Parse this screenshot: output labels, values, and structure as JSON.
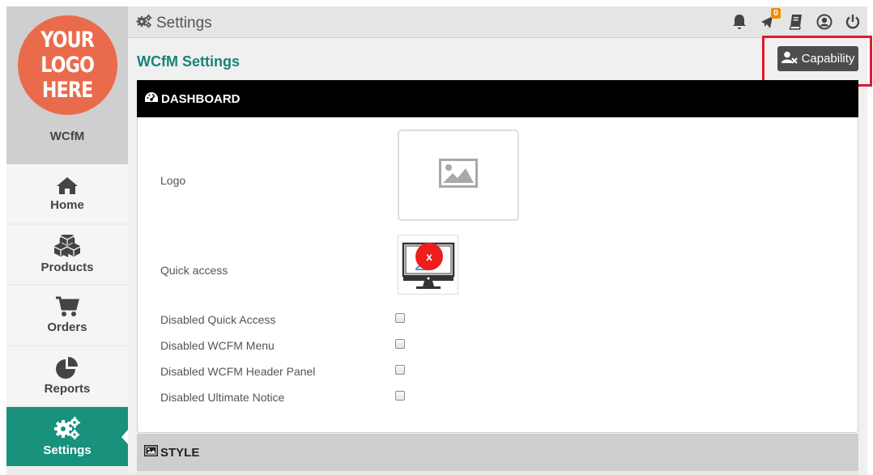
{
  "sidebar": {
    "logo_lines": [
      "YOUR",
      "LOGO",
      "HERE"
    ],
    "store_name": "WCfM",
    "items": [
      {
        "label": "Home",
        "icon": "home-icon"
      },
      {
        "label": "Products",
        "icon": "cubes-icon"
      },
      {
        "label": "Orders",
        "icon": "cart-icon"
      },
      {
        "label": "Reports",
        "icon": "pie-chart-icon"
      },
      {
        "label": "Settings",
        "icon": "gears-icon",
        "active": true
      }
    ]
  },
  "header": {
    "title": "Settings",
    "icons": [
      "bell-icon",
      "megaphone-icon",
      "book-icon",
      "user-circle-icon",
      "power-icon"
    ],
    "megaphone_badge": "0"
  },
  "main": {
    "title": "WCfM Settings",
    "capability_button": "Capability",
    "dashboard_section": {
      "title": "DASHBOARD",
      "logo_label": "Logo",
      "quick_access_label": "Quick access",
      "quick_access_remove": "x",
      "checkboxes": [
        {
          "label": "Disabled Quick Access",
          "checked": false
        },
        {
          "label": "Disabled WCFM Menu",
          "checked": false
        },
        {
          "label": "Disabled WCFM Header Panel",
          "checked": false
        },
        {
          "label": "Disabled Ultimate Notice",
          "checked": false
        }
      ]
    },
    "style_section": {
      "title": "STYLE"
    }
  },
  "colors": {
    "accent": "#18917d",
    "title_teal": "#17827a",
    "logo_orange": "#ea6b4b",
    "highlight_red": "#e01a2e",
    "badge_orange": "#f09000"
  }
}
